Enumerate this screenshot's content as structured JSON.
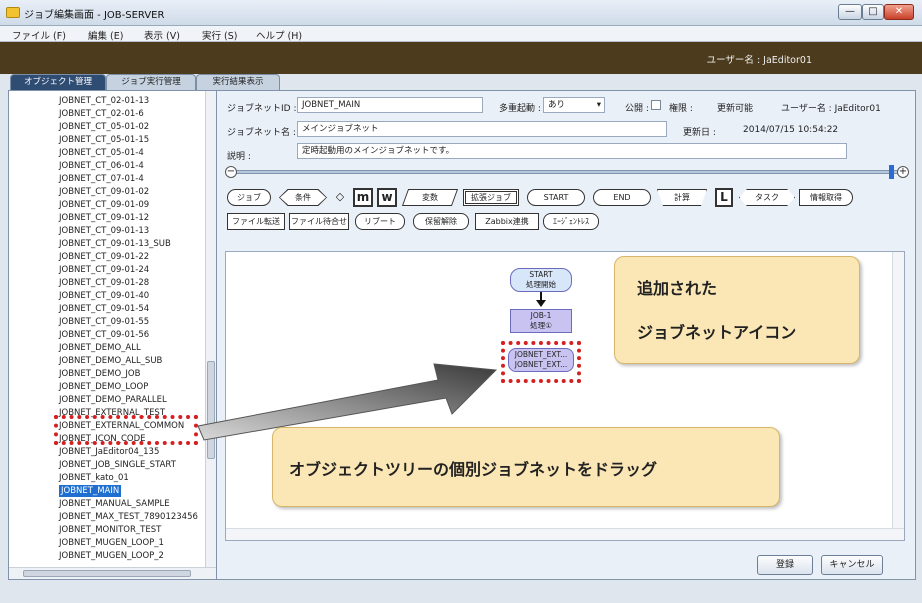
{
  "window": {
    "title": "ジョブ編集画面 - JOB-SERVER",
    "minimize_label": "—",
    "maximize_label": "□",
    "close_label": "✕"
  },
  "menu": [
    "ファイル (F)",
    "編集 (E)",
    "表示 (V)",
    "実行 (S)",
    "ヘルプ (H)"
  ],
  "header": {
    "user": "ユーザー名 : JaEditor01"
  },
  "tabs": [
    "オブジェクト管理",
    "ジョブ実行管理",
    "実行結果表示"
  ],
  "tree": {
    "items": [
      "JOBNET_CT_02-01-13",
      "JOBNET_CT_02-01-6",
      "JOBNET_CT_05-01-02",
      "JOBNET_CT_05-01-15",
      "JOBNET_CT_05-01-4",
      "JOBNET_CT_06-01-4",
      "JOBNET_CT_07-01-4",
      "JOBNET_CT_09-01-02",
      "JOBNET_CT_09-01-09",
      "JOBNET_CT_09-01-12",
      "JOBNET_CT_09-01-13",
      "JOBNET_CT_09-01-13_SUB",
      "JOBNET_CT_09-01-22",
      "JOBNET_CT_09-01-24",
      "JOBNET_CT_09-01-28",
      "JOBNET_CT_09-01-40",
      "JOBNET_CT_09-01-54",
      "JOBNET_CT_09-01-55",
      "JOBNET_CT_09-01-56",
      "JOBNET_DEMO_ALL",
      "JOBNET_DEMO_ALL_SUB",
      "JOBNET_DEMO_JOB",
      "JOBNET_DEMO_LOOP",
      "JOBNET_DEMO_PARALLEL",
      "JOBNET_EXTERNAL_TEST",
      "JOBNET_EXTERNAL_COMMON",
      "JOBNET_ICON_CODE",
      "JOBNET_JaEditor04_135",
      "JOBNET_JOB_SINGLE_START",
      "JOBNET_kato_01",
      "JOBNET_MAIN",
      "JOBNET_MANUAL_SAMPLE",
      "JOBNET_MAX_TEST_7890123456",
      "JOBNET_MONITOR_TEST",
      "JOBNET_MUGEN_LOOP_1",
      "JOBNET_MUGEN_LOOP_2"
    ],
    "selected": "JOBNET_MAIN"
  },
  "form": {
    "jobnet_id_label": "ジョブネットID :",
    "jobnet_id_value": "JOBNET_MAIN",
    "multi_start_label": "多重起動 :",
    "multi_start_value": "あり",
    "public_label": "公開 :",
    "permission_label": "権限 :",
    "permission_value": "更新可能",
    "user_label": "ユーザー名 : JaEditor01",
    "jobnet_name_label": "ジョブネット名 :",
    "jobnet_name_value": "メインジョブネット",
    "updated_label": "更新日 :",
    "updated_value": "2014/07/15 10:54:22",
    "desc_label": "説明 :",
    "desc_value": "定時起動用のメインジョブネットです。"
  },
  "toolbox": {
    "row1": [
      "ジョブ",
      "条件",
      "",
      "m",
      "w",
      "変数",
      "拡張ジョブ",
      "START",
      "END",
      "計算",
      "L",
      "タスク",
      "情報取得"
    ],
    "row2": [
      "ファイル転送",
      "ファイル待合せ",
      "リブート",
      "保留解除",
      "Zabbix連携",
      "ｴｰｼﾞｪﾝﾄﾚｽ"
    ]
  },
  "canvas": {
    "start_node": [
      "START",
      "処理開始"
    ],
    "job_node": [
      "JOB-1",
      "処理①"
    ],
    "added_node": [
      "JOBNET_EXT...",
      "JOBNET_EXT..."
    ]
  },
  "callouts": {
    "added": [
      "追加された",
      "ジョブネットアイコン"
    ],
    "drag": "オブジェクトツリーの個別ジョブネットをドラッグ"
  },
  "buttons": {
    "register": "登録",
    "cancel": "キャンセル"
  },
  "colors": {
    "selected_row": "#1f6fd0",
    "highlight_dash": "#d42020",
    "callout_bg": "#fbe7b5",
    "header_dark": "#4d3b1d"
  }
}
